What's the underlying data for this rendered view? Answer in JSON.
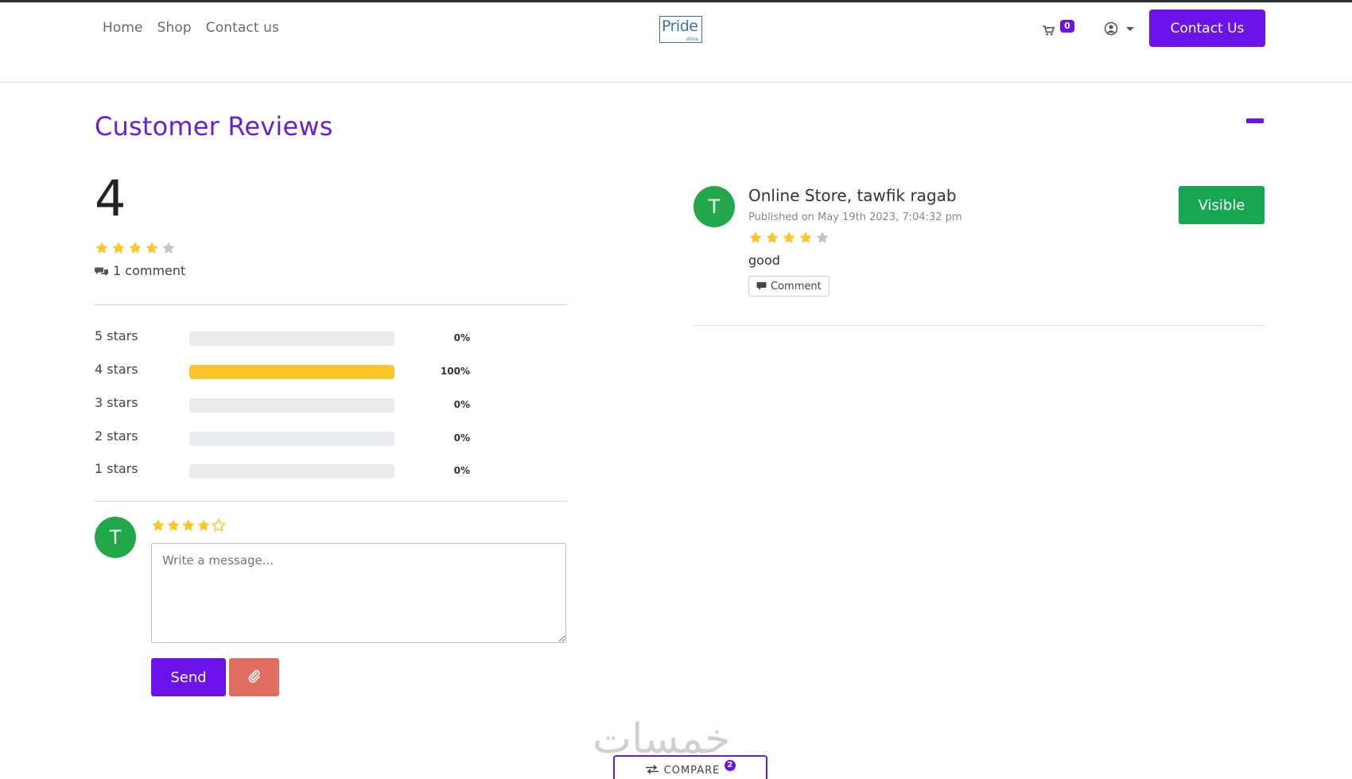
{
  "nav": {
    "links": [
      "Home",
      "Shop",
      "Contact us"
    ],
    "logo_text": "Pride",
    "logo_sub": "store",
    "cart_count": "0",
    "contact_button": "Contact Us"
  },
  "reviews": {
    "title": "Customer Reviews",
    "average": "4",
    "average_stars": 4,
    "comment_count_label": "1 comment",
    "breakdown": [
      {
        "label": "5 stars",
        "percent": "0%",
        "fill": 0
      },
      {
        "label": "4 stars",
        "percent": "100%",
        "fill": 1
      },
      {
        "label": "3 stars",
        "percent": "0%",
        "fill": 0
      },
      {
        "label": "2 stars",
        "percent": "0%",
        "fill": 0
      },
      {
        "label": "1 stars",
        "percent": "0%",
        "fill": 0
      }
    ],
    "composer": {
      "avatar_letter": "T",
      "rating": 4,
      "placeholder": "Write a message...",
      "send_label": "Send"
    },
    "items": [
      {
        "avatar_letter": "T",
        "author": "Online Store, tawfik ragab",
        "date": "Published on May 19th 2023, 7:04:32 pm",
        "rating": 4,
        "text": "good",
        "comment_label": "Comment",
        "visibility_label": "Visible"
      }
    ]
  },
  "footer": {
    "watermark": "خمسات",
    "compare_label": "COMPARE",
    "compare_count": "2"
  },
  "colors": {
    "accent": "#6b13e8",
    "star": "#fcc52b",
    "star_empty": "#c4c4c4",
    "success": "#19a650",
    "avatar": "#22a84a",
    "danger": "#e06d5f"
  }
}
